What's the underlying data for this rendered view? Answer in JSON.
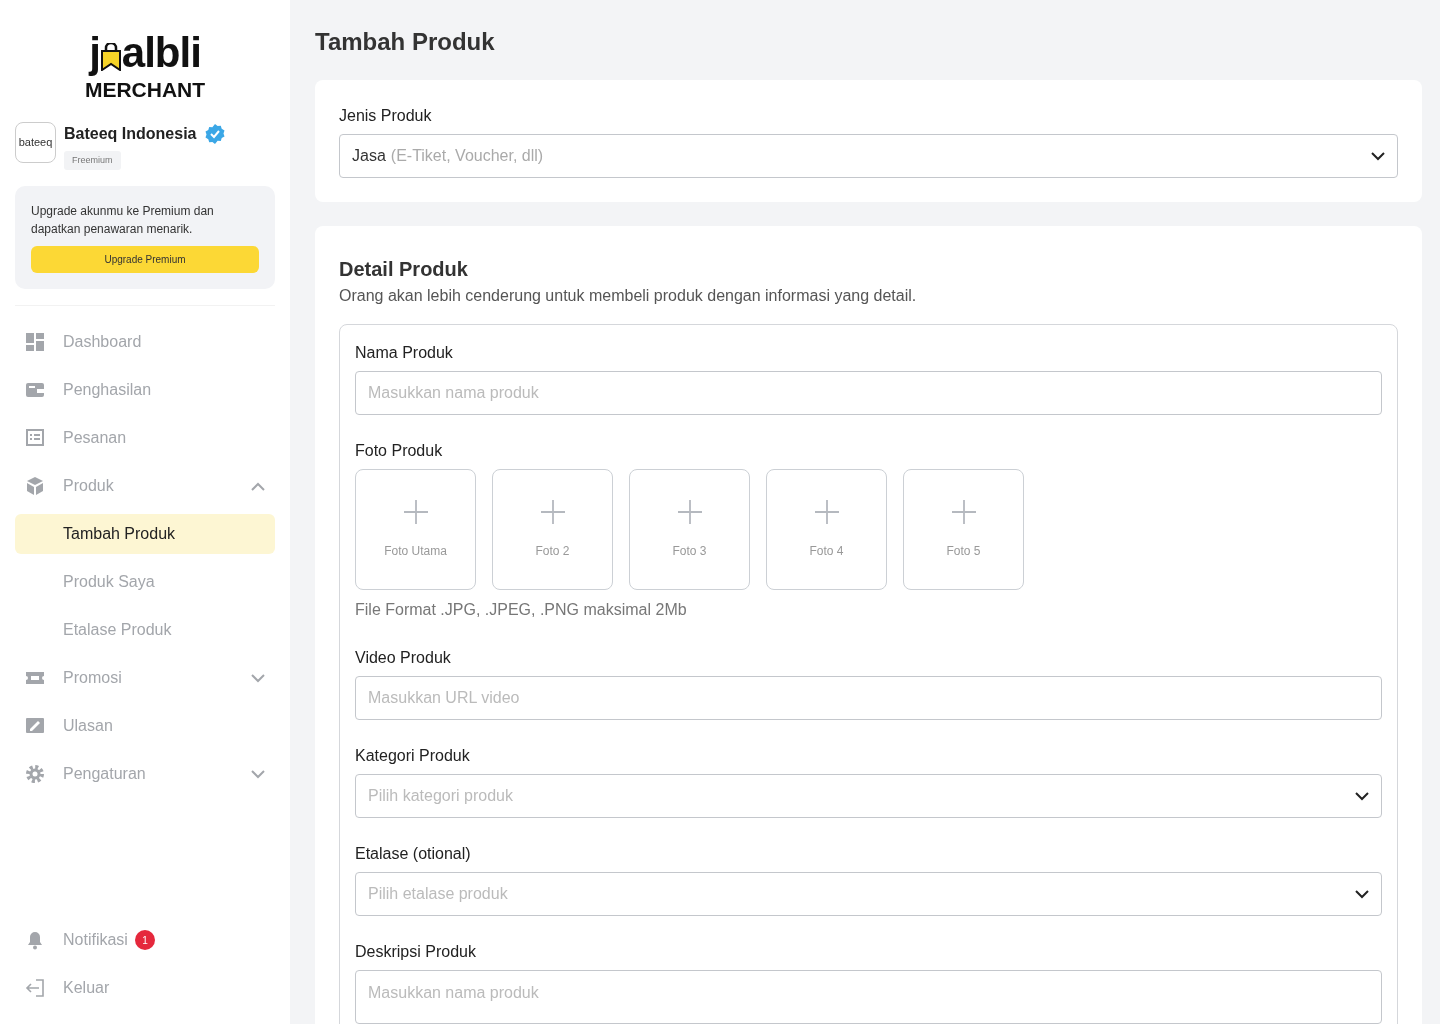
{
  "sidebar": {
    "logo": {
      "before": "j",
      "after": "albli",
      "subtitle": "MERCHANT"
    },
    "profile": {
      "avatar_text": "bateeq",
      "name": "Bateeq Indonesia",
      "verified": true,
      "plan": "Freemium"
    },
    "upgrade": {
      "text": "Upgrade akunmu ke Premium dan dapatkan penawaran menarik.",
      "button": "Upgrade Premium"
    },
    "items": [
      {
        "label": "Dashboard"
      },
      {
        "label": "Penghasilan"
      },
      {
        "label": "Pesanan"
      },
      {
        "label": "Produk",
        "expanded": true,
        "children": [
          {
            "label": "Tambah Produk",
            "selected": true
          },
          {
            "label": "Produk Saya",
            "selected": false
          },
          {
            "label": "Etalase Produk",
            "selected": false
          }
        ]
      },
      {
        "label": "Promosi",
        "expanded": false
      },
      {
        "label": "Ulasan"
      },
      {
        "label": "Pengaturan",
        "expanded": false
      }
    ],
    "bottom_items": [
      {
        "label": "Notifikasi",
        "badge": "1"
      },
      {
        "label": "Keluar"
      }
    ]
  },
  "page_title": "Tambah Produk",
  "type_card": {
    "label": "Jenis Produk",
    "value": "Jasa",
    "value_note": "(E-Tiket, Voucher, dll)"
  },
  "detail_card": {
    "title": "Detail Produk",
    "subtitle": "Orang akan lebih cenderung untuk membeli produk dengan informasi yang detail.",
    "fields": [
      {
        "kind": "input",
        "label": "Nama Produk",
        "placeholder": "Masukkan nama produk"
      },
      {
        "kind": "photos",
        "label": "Foto Produk",
        "slots": [
          "Foto Utama",
          "Foto 2",
          "Foto 3",
          "Foto 4",
          "Foto 5"
        ],
        "hint": "File Format .JPG, .JPEG, .PNG maksimal 2Mb"
      },
      {
        "kind": "input",
        "label": "Video Produk",
        "placeholder": "Masukkan URL video"
      },
      {
        "kind": "select",
        "label": "Kategori Produk",
        "placeholder": "Pilih kategori produk"
      },
      {
        "kind": "select",
        "label": "Etalase (otional)",
        "placeholder": "Pilih etalase produk"
      },
      {
        "kind": "textarea",
        "label": "Deskripsi Produk",
        "placeholder": "Masukkan nama produk"
      }
    ]
  }
}
